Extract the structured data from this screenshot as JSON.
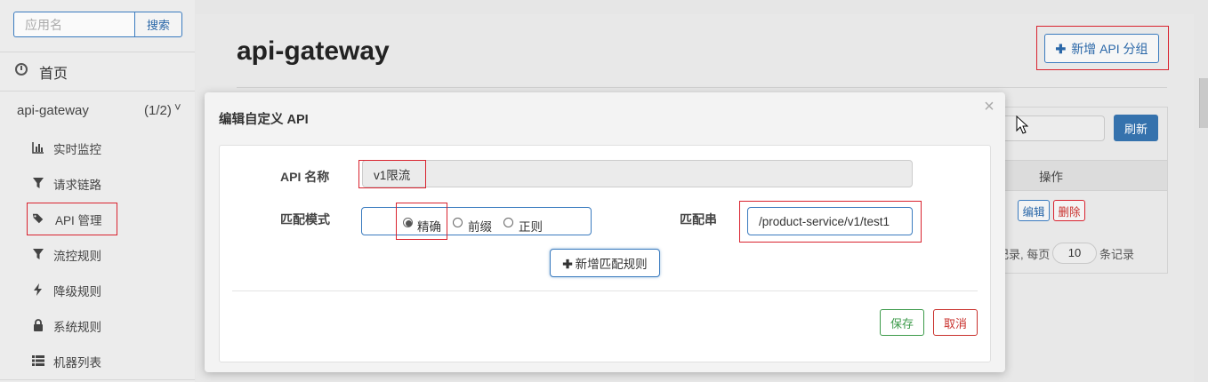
{
  "sidebar": {
    "search_placeholder": "应用名",
    "search_button": "搜索",
    "home_label": "首页",
    "app": {
      "name": "api-gateway",
      "count": "(1/2)",
      "chevron": "˅"
    },
    "items": [
      {
        "label": "实时监控",
        "icon": "bar-chart-icon"
      },
      {
        "label": "请求链路",
        "icon": "filter-icon"
      },
      {
        "label": "API 管理",
        "icon": "tags-icon",
        "active": true
      },
      {
        "label": "流控规则",
        "icon": "filter-icon"
      },
      {
        "label": "降级规则",
        "icon": "flash-icon"
      },
      {
        "label": "系统规则",
        "icon": "lock-icon"
      },
      {
        "label": "机器列表",
        "icon": "list-icon"
      }
    ]
  },
  "main": {
    "title": "api-gateway",
    "add_group_button": "新增 API 分组",
    "refresh_button": "刷新",
    "table_header_ops": "操作",
    "edit_button": "编辑",
    "delete_button": "删除",
    "pagination": {
      "prefix": "记录, 每页",
      "page_size": "10",
      "suffix": "条记录"
    }
  },
  "modal": {
    "title": "编辑自定义 API",
    "close": "×",
    "api_name_label": "API 名称",
    "api_name_value": "v1限流",
    "match_mode_label": "匹配模式",
    "match_modes": [
      {
        "label": "精确",
        "selected": true
      },
      {
        "label": "前缀",
        "selected": false
      },
      {
        "label": "正则",
        "selected": false
      }
    ],
    "pattern_label": "匹配串",
    "pattern_value": "/product-service/v1/test1",
    "add_rule_button": "新增匹配规则",
    "save_button": "保存",
    "cancel_button": "取消"
  },
  "colors": {
    "accent": "#3a7bbf",
    "danger": "#d9232f",
    "success": "#3c9a4a",
    "primary_fill": "#3572ad"
  }
}
